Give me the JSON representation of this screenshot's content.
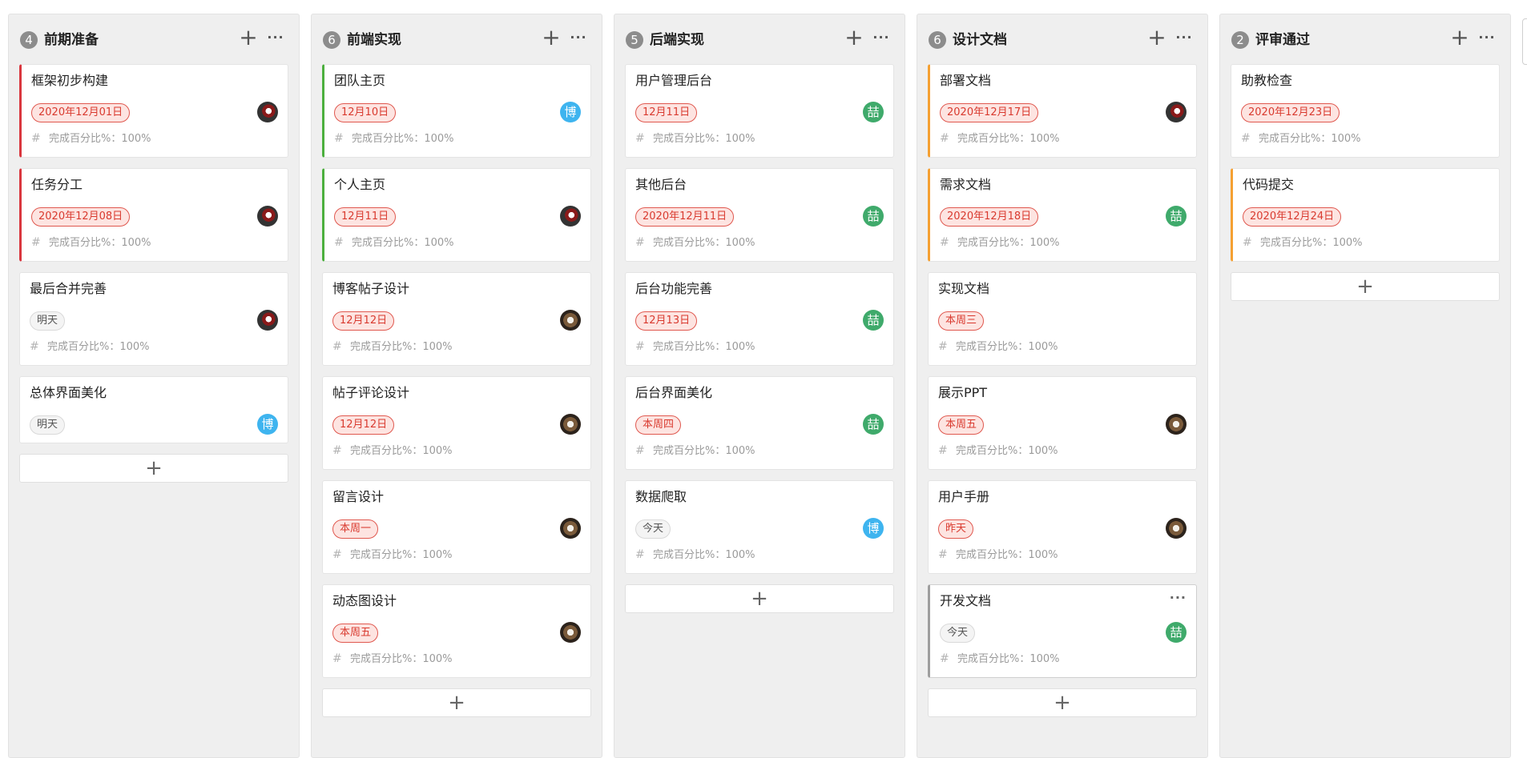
{
  "meta_label": "完成百分比%：",
  "columns": [
    {
      "count": "4",
      "title": "前期准备",
      "cards": [
        {
          "title": "框架初步构建",
          "date": "2020年12月01日",
          "percent": "100%",
          "avatar": "photo-dark",
          "accent": "red",
          "date_style": "red",
          "short": false
        },
        {
          "title": "任务分工",
          "date": "2020年12月08日",
          "percent": "100%",
          "avatar": "photo-dark",
          "accent": "red",
          "date_style": "red",
          "short": false
        },
        {
          "title": "最后合并完善",
          "date": "明天",
          "percent": "100%",
          "avatar": "photo-dark",
          "accent": "none",
          "date_style": "neutral",
          "short": false
        },
        {
          "title": "总体界面美化",
          "date": "明天",
          "avatar": "blue",
          "avatar_text": "博",
          "accent": "none",
          "date_style": "neutral",
          "short": true
        }
      ]
    },
    {
      "count": "6",
      "title": "前端实现",
      "cards": [
        {
          "title": "团队主页",
          "date": "12月10日",
          "percent": "100%",
          "avatar": "blue",
          "avatar_text": "博",
          "accent": "green",
          "date_style": "red",
          "short": false
        },
        {
          "title": "个人主页",
          "date": "12月11日",
          "percent": "100%",
          "avatar": "photo-dark",
          "accent": "green",
          "date_style": "red",
          "short": false
        },
        {
          "title": "博客帖子设计",
          "date": "12月12日",
          "percent": "100%",
          "avatar": "photo-warm",
          "accent": "none",
          "date_style": "red",
          "short": false
        },
        {
          "title": "帖子评论设计",
          "date": "12月12日",
          "percent": "100%",
          "avatar": "photo-warm",
          "accent": "none",
          "date_style": "red",
          "short": false
        },
        {
          "title": "留言设计",
          "date": "本周一",
          "percent": "100%",
          "avatar": "photo-warm",
          "accent": "none",
          "date_style": "red",
          "short": false
        },
        {
          "title": "动态图设计",
          "date": "本周五",
          "percent": "100%",
          "avatar": "photo-warm",
          "accent": "none",
          "date_style": "red",
          "short": false
        }
      ]
    },
    {
      "count": "5",
      "title": "后端实现",
      "cards": [
        {
          "title": "用户管理后台",
          "date": "12月11日",
          "percent": "100%",
          "avatar": "green",
          "avatar_text": "喆",
          "accent": "none",
          "date_style": "red",
          "short": false
        },
        {
          "title": "其他后台",
          "date": "2020年12月11日",
          "percent": "100%",
          "avatar": "green",
          "avatar_text": "喆",
          "accent": "none",
          "date_style": "red",
          "short": false
        },
        {
          "title": "后台功能完善",
          "date": "12月13日",
          "percent": "100%",
          "avatar": "green",
          "avatar_text": "喆",
          "accent": "none",
          "date_style": "red",
          "short": false
        },
        {
          "title": "后台界面美化",
          "date": "本周四",
          "percent": "100%",
          "avatar": "green",
          "avatar_text": "喆",
          "accent": "none",
          "date_style": "red",
          "short": false
        },
        {
          "title": "数据爬取",
          "date": "今天",
          "percent": "100%",
          "avatar": "blue",
          "avatar_text": "博",
          "accent": "none",
          "date_style": "neutral",
          "short": false
        }
      ]
    },
    {
      "count": "6",
      "title": "设计文档",
      "cards": [
        {
          "title": "部署文档",
          "date": "2020年12月17日",
          "percent": "100%",
          "avatar": "photo-dark",
          "accent": "orange",
          "date_style": "red",
          "short": false
        },
        {
          "title": "需求文档",
          "date": "2020年12月18日",
          "percent": "100%",
          "avatar": "green",
          "avatar_text": "喆",
          "accent": "orange",
          "date_style": "red",
          "short": false
        },
        {
          "title": "实现文档",
          "date": "本周三",
          "percent": "100%",
          "avatar": "none",
          "accent": "none",
          "date_style": "red",
          "short": false
        },
        {
          "title": "展示PPT",
          "date": "本周五",
          "percent": "100%",
          "avatar": "photo-warm",
          "accent": "none",
          "date_style": "red",
          "short": false
        },
        {
          "title": "用户手册",
          "date": "昨天",
          "percent": "100%",
          "avatar": "photo-warm",
          "accent": "none",
          "date_style": "red",
          "short": false
        },
        {
          "title": "开发文档",
          "date": "今天",
          "percent": "100%",
          "avatar": "green",
          "avatar_text": "喆",
          "accent": "grey",
          "date_style": "neutral",
          "short": false,
          "more": "···"
        }
      ]
    },
    {
      "count": "2",
      "title": "评审通过",
      "cards": [
        {
          "title": "助教检查",
          "date": "2020年12月23日",
          "percent": "100%",
          "avatar": "none",
          "accent": "none",
          "date_style": "red",
          "short": false
        },
        {
          "title": "代码提交",
          "date": "2020年12月24日",
          "percent": "100%",
          "avatar": "none",
          "accent": "orange",
          "date_style": "red",
          "short": false
        }
      ]
    }
  ],
  "icons": {
    "add": "plus-icon",
    "more": "more-icon",
    "tag": "hash-icon"
  },
  "colors": {
    "accent_red": "#d9363e",
    "accent_green": "#4caf3e",
    "accent_orange": "#f5a032",
    "avatar_blue": "#3eb4ef",
    "avatar_green": "#3faa6b",
    "date_red": "#d93a2f"
  }
}
